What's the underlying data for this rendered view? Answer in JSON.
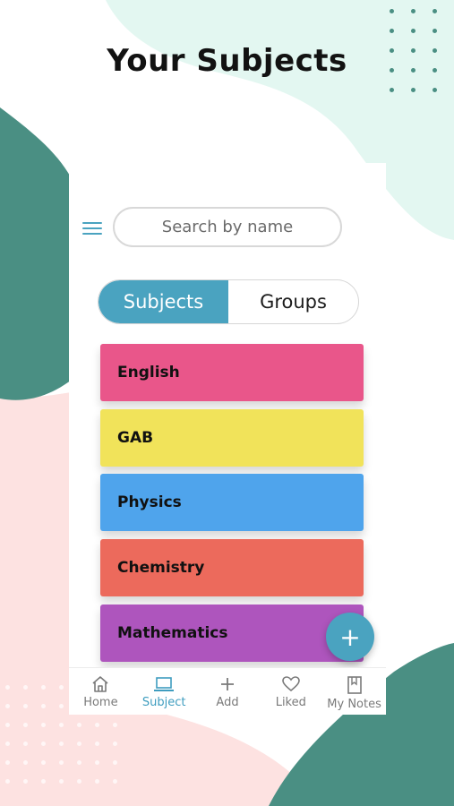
{
  "page": {
    "title": "Your Subjects"
  },
  "search": {
    "placeholder": "Search by name"
  },
  "tabs": [
    {
      "label": "Subjects",
      "active": true
    },
    {
      "label": "Groups",
      "active": false
    }
  ],
  "subjects": [
    {
      "label": "English",
      "color": "#e9568a"
    },
    {
      "label": "GAB",
      "color": "#f1e35a"
    },
    {
      "label": "Physics",
      "color": "#4fa4ec"
    },
    {
      "label": "Chemistry",
      "color": "#ec6a5c"
    },
    {
      "label": "Mathematics",
      "color": "#ae55bd"
    }
  ],
  "fab": {
    "label": "+"
  },
  "bottom_nav": [
    {
      "label": "Home",
      "icon": "home-icon",
      "active": false
    },
    {
      "label": "Subject",
      "icon": "laptop-icon",
      "active": true
    },
    {
      "label": "Add",
      "icon": "plus-icon",
      "active": false
    },
    {
      "label": "Liked",
      "icon": "heart-icon",
      "active": false
    },
    {
      "label": "My Notes",
      "icon": "notebook-icon",
      "active": false
    }
  ],
  "colors": {
    "accent": "#4aa3c0",
    "teal_shape": "#4a8f83",
    "mint_shape": "#e3f7f1",
    "pink_shape": "#fde2e1"
  }
}
